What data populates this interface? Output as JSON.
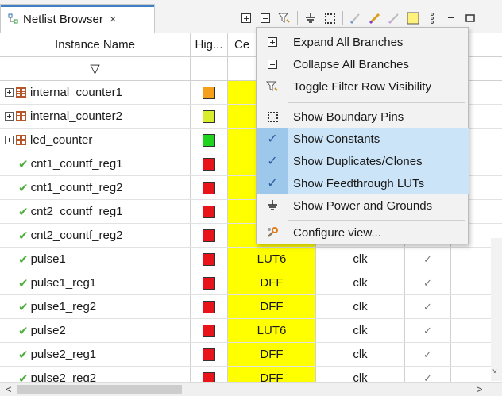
{
  "tab": {
    "title": "Netlist Browser",
    "close": "×",
    "accent_color": "#3f7fc6"
  },
  "toolbar": {
    "buttons": [
      "expand-all",
      "collapse-all",
      "filter-row",
      "power-ground",
      "boundary-pins",
      "highlight-tool-1",
      "highlight-tool-2",
      "highlight-tool-3",
      "yellow-square",
      "view-menu",
      "minimize",
      "maximize"
    ]
  },
  "table": {
    "headers": {
      "name": "Instance Name",
      "hig": "Hig...",
      "cell": "Ce",
      "filter": "▽"
    },
    "rows": [
      {
        "name": "internal_counter1",
        "kind": "group",
        "color": "#f5a01a",
        "cell": "",
        "clk": "",
        "check": ""
      },
      {
        "name": "internal_counter2",
        "kind": "group",
        "color": "#d9ee2a",
        "cell": "",
        "clk": "",
        "check": ""
      },
      {
        "name": "led_counter",
        "kind": "group",
        "color": "#1ed41e",
        "cell": "",
        "clk": "",
        "check": ""
      },
      {
        "name": "cnt1_countf_reg1",
        "kind": "leaf",
        "color": "#e8141a",
        "cell": "",
        "clk": "",
        "check": ""
      },
      {
        "name": "cnt1_countf_reg2",
        "kind": "leaf",
        "color": "#e8141a",
        "cell": "",
        "clk": "",
        "check": ""
      },
      {
        "name": "cnt2_countf_reg1",
        "kind": "leaf",
        "color": "#e8141a",
        "cell": "",
        "clk": "",
        "check": ""
      },
      {
        "name": "cnt2_countf_reg2",
        "kind": "leaf",
        "color": "#e8141a",
        "cell": "",
        "clk": "",
        "check": ""
      },
      {
        "name": "pulse1",
        "kind": "leaf",
        "color": "#e8141a",
        "cell": "LUT6",
        "clk": "clk",
        "check": "✓"
      },
      {
        "name": "pulse1_reg1",
        "kind": "leaf",
        "color": "#e8141a",
        "cell": "DFF",
        "clk": "clk",
        "check": "✓"
      },
      {
        "name": "pulse1_reg2",
        "kind": "leaf",
        "color": "#e8141a",
        "cell": "DFF",
        "clk": "clk",
        "check": "✓"
      },
      {
        "name": "pulse2",
        "kind": "leaf",
        "color": "#e8141a",
        "cell": "LUT6",
        "clk": "clk",
        "check": "✓"
      },
      {
        "name": "pulse2_reg1",
        "kind": "leaf",
        "color": "#e8141a",
        "cell": "DFF",
        "clk": "clk",
        "check": "✓"
      },
      {
        "name": "pulse2_reg2",
        "kind": "leaf",
        "color": "#e8141a",
        "cell": "DFF",
        "clk": "clk",
        "check": "✓"
      }
    ]
  },
  "menu": {
    "items": [
      {
        "label": "Expand All Branches",
        "icon": "expand-box-icon",
        "checked": false
      },
      {
        "label": "Collapse All Branches",
        "icon": "collapse-box-icon",
        "checked": false
      },
      {
        "label": "Toggle Filter Row Visibility",
        "icon": "filter-icon",
        "checked": false
      },
      {
        "label": "Show Boundary Pins",
        "icon": "boundary-pins-icon",
        "checked": false
      },
      {
        "label": "Show Constants",
        "icon": "check-icon",
        "checked": true
      },
      {
        "label": "Show Duplicates/Clones",
        "icon": "check-icon",
        "checked": true
      },
      {
        "label": "Show Feedthrough LUTs",
        "icon": "check-icon",
        "checked": true
      },
      {
        "label": "Show Power and Grounds",
        "icon": "ground-icon",
        "checked": false
      },
      {
        "label": "Configure view...",
        "icon": "wrench-icon",
        "checked": false
      }
    ]
  },
  "scroll": {
    "left_arrow": "<",
    "right_arrow": ">",
    "down_arrow": "˅"
  }
}
